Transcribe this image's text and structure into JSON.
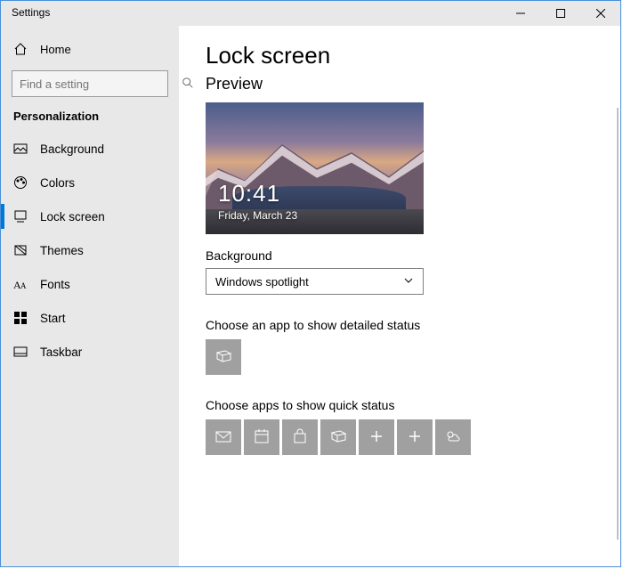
{
  "window": {
    "title": "Settings"
  },
  "sidebar": {
    "home_label": "Home",
    "search_placeholder": "Find a setting",
    "category_label": "Personalization",
    "items": [
      {
        "label": "Background"
      },
      {
        "label": "Colors"
      },
      {
        "label": "Lock screen"
      },
      {
        "label": "Themes"
      },
      {
        "label": "Fonts"
      },
      {
        "label": "Start"
      },
      {
        "label": "Taskbar"
      }
    ]
  },
  "main": {
    "heading": "Lock screen",
    "preview_label": "Preview",
    "preview_time": "10:41",
    "preview_date": "Friday, March 23",
    "background_label": "Background",
    "background_value": "Windows spotlight",
    "detailed_label": "Choose an app to show detailed status",
    "quick_label": "Choose apps to show quick status",
    "quick_tiles": [
      {
        "icon": "mail-icon"
      },
      {
        "icon": "calendar-icon"
      },
      {
        "icon": "store-icon"
      },
      {
        "icon": "windows-3d-icon"
      },
      {
        "icon": "plus-icon"
      },
      {
        "icon": "plus-icon"
      },
      {
        "icon": "weather-icon"
      }
    ]
  }
}
